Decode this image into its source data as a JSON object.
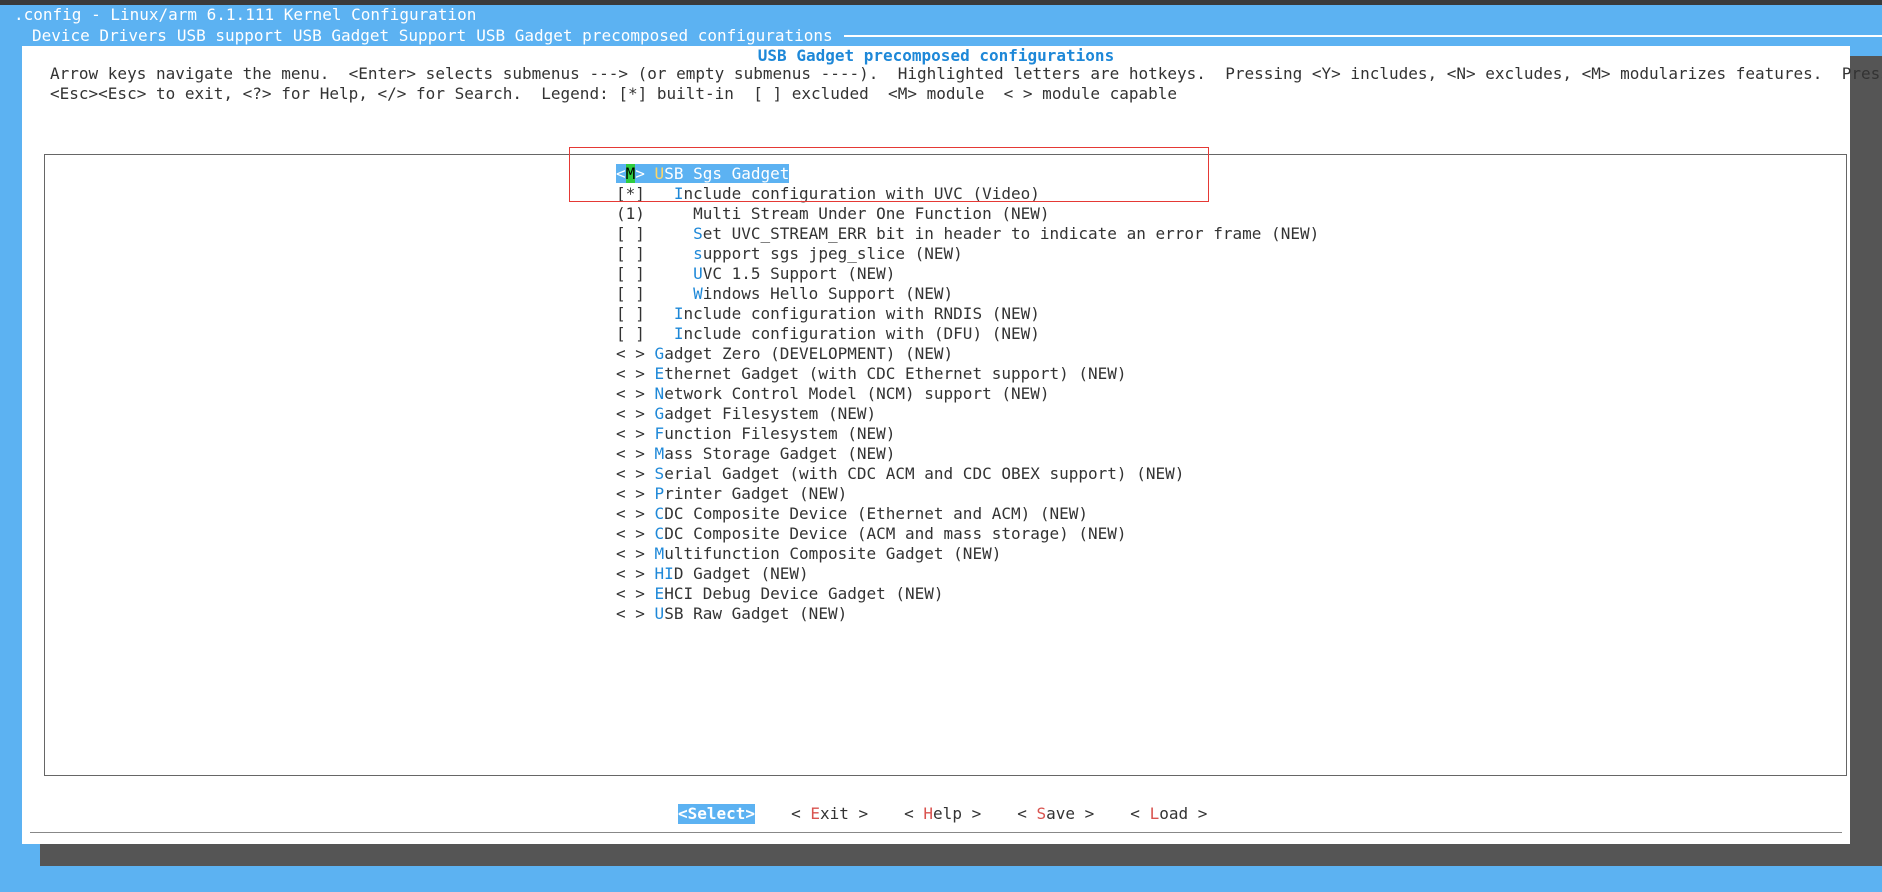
{
  "window": {
    "title": ".config - Linux/arm 6.1.111 Kernel Configuration"
  },
  "breadcrumb": [
    "Device Drivers",
    "USB support",
    "USB Gadget Support",
    "USB Gadget precomposed configurations"
  ],
  "dialog": {
    "title": "USB Gadget precomposed configurations",
    "help_line1": "Arrow keys navigate the menu.  <Enter> selects submenus ---> (or empty submenus ----).  Highlighted letters are hotkeys.  Pressing <Y> includes, <N> excludes, <M> modularizes features.  Press",
    "help_line2": "<Esc><Esc> to exit, <?> for Help, </> for Search.  Legend: [*] built-in  [ ] excluded  <M> module  < > module capable"
  },
  "menu": {
    "selected": {
      "marker_open": "<",
      "marker_value": "M",
      "marker_close": "> ",
      "hotkey": "U",
      "rest": "SB Sgs Gadget"
    },
    "items": [
      {
        "mark": "[*]",
        "indent": "  ",
        "hotkey": "I",
        "rest": "nclude configuration with UVC (Video)"
      },
      {
        "mark": "(1)",
        "indent": "    ",
        "hotkey": "",
        "rest": "Multi Stream Under One Function (NEW)"
      },
      {
        "mark": "[ ]",
        "indent": "    ",
        "hotkey": "S",
        "rest": "et UVC_STREAM_ERR bit in header to indicate an error frame (NEW)"
      },
      {
        "mark": "[ ]",
        "indent": "    ",
        "hotkey": "s",
        "rest": "upport sgs jpeg_slice (NEW)"
      },
      {
        "mark": "[ ]",
        "indent": "    ",
        "hotkey": "U",
        "rest": "VC 1.5 Support (NEW)"
      },
      {
        "mark": "[ ]",
        "indent": "    ",
        "hotkey": "W",
        "rest": "indows Hello Support (NEW)"
      },
      {
        "mark": "[ ]",
        "indent": "  ",
        "hotkey": "I",
        "rest": "nclude configuration with RNDIS (NEW)"
      },
      {
        "mark": "[ ]",
        "indent": "  ",
        "hotkey": "I",
        "rest": "nclude configuration with (DFU) (NEW)"
      },
      {
        "mark": "< >",
        "indent": "",
        "hotkey": "G",
        "rest": "adget Zero (DEVELOPMENT) (NEW)"
      },
      {
        "mark": "< >",
        "indent": "",
        "hotkey": "E",
        "rest": "thernet Gadget (with CDC Ethernet support) (NEW)"
      },
      {
        "mark": "< >",
        "indent": "",
        "hotkey": "N",
        "rest": "etwork Control Model (NCM) support (NEW)"
      },
      {
        "mark": "< >",
        "indent": "",
        "hotkey": "G",
        "rest": "adget Filesystem (NEW)"
      },
      {
        "mark": "< >",
        "indent": "",
        "hotkey": "F",
        "rest": "unction Filesystem (NEW)"
      },
      {
        "mark": "< >",
        "indent": "",
        "hotkey": "M",
        "rest": "ass Storage Gadget (NEW)"
      },
      {
        "mark": "< >",
        "indent": "",
        "hotkey": "S",
        "rest": "erial Gadget (with CDC ACM and CDC OBEX support) (NEW)"
      },
      {
        "mark": "< >",
        "indent": "",
        "hotkey": "P",
        "rest": "rinter Gadget (NEW)"
      },
      {
        "mark": "< >",
        "indent": "",
        "hotkey": "C",
        "rest": "DC Composite Device (Ethernet and ACM) (NEW)"
      },
      {
        "mark": "< >",
        "indent": "",
        "hotkey": "C",
        "rest": "DC Composite Device (ACM and mass storage) (NEW)"
      },
      {
        "mark": "< >",
        "indent": "",
        "hotkey": "M",
        "rest": "ultifunction Composite Gadget (NEW)"
      },
      {
        "mark": "< >",
        "indent": "",
        "hotkey": "HI",
        "rest": "D Gadget (NEW)"
      },
      {
        "mark": "< >",
        "indent": "",
        "hotkey": "E",
        "rest": "HCI Debug Device Gadget (NEW)"
      },
      {
        "mark": "< >",
        "indent": "",
        "hotkey": "U",
        "rest": "SB Raw Gadget (NEW)"
      }
    ]
  },
  "buttons": {
    "select": "<Select>",
    "exit_open": "< ",
    "exit_hotkey": "E",
    "exit_rest": "xit >",
    "help_open": "< ",
    "help_hotkey": "H",
    "help_rest": "elp >",
    "save_open": "< ",
    "save_hotkey": "S",
    "save_rest": "ave >",
    "load_open": "< ",
    "load_hotkey": "L",
    "load_rest": "oad >"
  }
}
